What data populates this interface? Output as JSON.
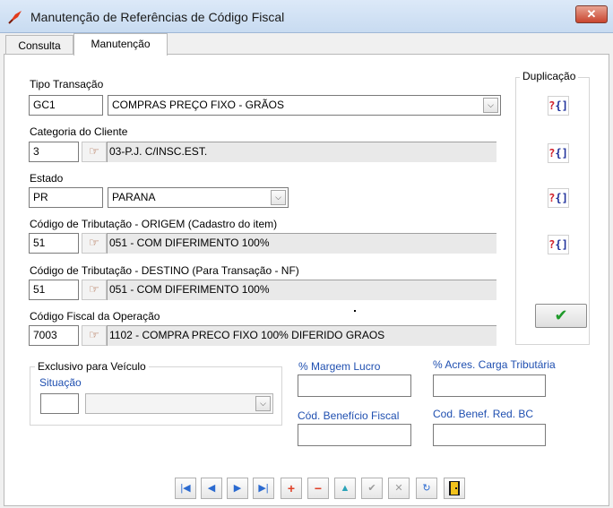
{
  "window": {
    "title": "Manutenção de Referências de Código Fiscal",
    "close_label": "✕"
  },
  "tabs": [
    {
      "label": "Consulta"
    },
    {
      "label": "Manutenção"
    }
  ],
  "tipo_transacao": {
    "label": "Tipo Transação",
    "code": "GC1",
    "description": "COMPRAS PREÇO FIXO - GRÃOS"
  },
  "categoria_cliente": {
    "label": "Categoria do Cliente",
    "code": "3",
    "description": "03-P.J. C/INSC.EST."
  },
  "estado": {
    "label": "Estado",
    "code": "PR",
    "description": "PARANA"
  },
  "trib_origem": {
    "label": "Código de Tributação - ORIGEM (Cadastro do item)",
    "code": "51",
    "description": "051 - COM DIFERIMENTO 100%"
  },
  "trib_destino": {
    "label": "Código de Tributação - DESTINO (Para Transação - NF)",
    "code": "51",
    "description": "051 - COM DIFERIMENTO 100%"
  },
  "cfop": {
    "label": "Código Fiscal da Operação",
    "code": "7003",
    "description": "1102 - COMPRA PRECO FIXO 100% DIFERIDO GRAOS"
  },
  "duplicacao": {
    "title": "Duplicação",
    "button_q": "?",
    "button_b": "{]"
  },
  "veiculo": {
    "title": "Exclusivo para Veículo",
    "situacao_label": "Situação",
    "situacao_code": "",
    "situacao_value": ""
  },
  "margem_lucro": {
    "label": "% Margem Lucro",
    "value": ""
  },
  "acres_carga": {
    "label": "% Acres. Carga Tributária",
    "value": ""
  },
  "cod_beneficio": {
    "label": "Cód. Benefício Fiscal",
    "value": ""
  },
  "cod_benef_red": {
    "label": "Cod. Benef. Red. BC",
    "value": ""
  },
  "icons": {
    "hand": "☞",
    "combo_arrow": "⌵",
    "confirm": "✔",
    "first": "|◀",
    "prev": "◀",
    "next": "▶",
    "last": "▶|",
    "insert": "+",
    "delete": "−",
    "edit": "▲",
    "post": "✔",
    "cancel": "✕",
    "refresh": "↻"
  },
  "colors": {
    "blue_label": "#1f4fb0",
    "confirm_green": "#1f9a2a",
    "close_red": "#c9452f"
  }
}
